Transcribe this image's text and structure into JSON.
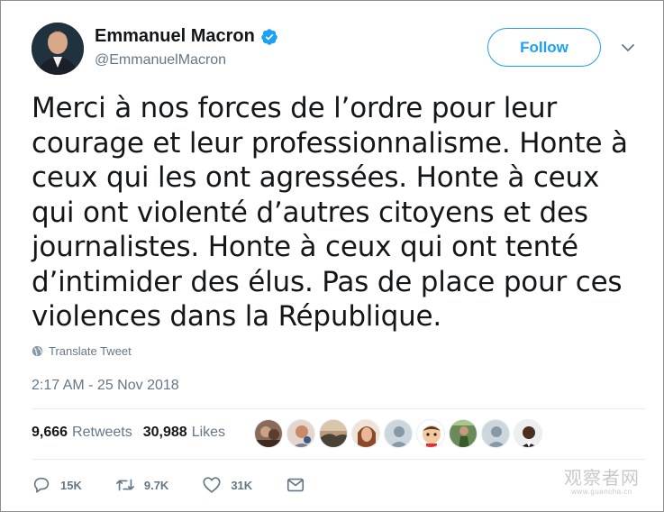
{
  "user": {
    "display_name": "Emmanuel Macron",
    "handle": "@EmmanuelMacron",
    "verified": true
  },
  "follow_label": "Follow",
  "tweet": {
    "text": "Merci à nos forces de l’ordre pour leur courage et leur professionnalisme. Honte à ceux qui les ont agressées. Honte à ceux qui ont violenté d’autres citoyens et des journalistes. Honte à ceux qui ont tenté d’intimider des élus. Pas de place pour ces violences dans la République.",
    "translate_label": "Translate Tweet",
    "timestamp": "2:17 AM - 25 Nov 2018"
  },
  "stats": {
    "retweets_count": "9,666",
    "retweets_label": "Retweets",
    "likes_count": "30,988",
    "likes_label": "Likes"
  },
  "actions": {
    "reply_count": "15K",
    "retweet_count": "9.7K",
    "like_count": "31K"
  },
  "watermark": {
    "main": "观察者网",
    "sub": "www.guancha.cn"
  },
  "colors": {
    "accent": "#1da1f2",
    "text": "#14171a",
    "secondary": "#657786"
  },
  "icons": [
    "verified-badge-icon",
    "chevron-down-icon",
    "globe-icon",
    "reply-icon",
    "retweet-icon",
    "heart-icon",
    "envelope-icon"
  ]
}
